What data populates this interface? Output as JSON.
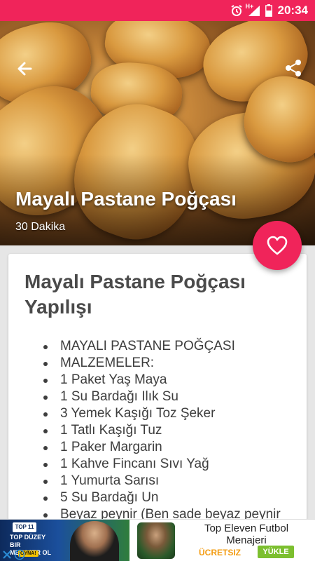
{
  "status_bar": {
    "time": "20:34",
    "network_label": "H+",
    "background": "#f0245a"
  },
  "recipe": {
    "title": "Mayalı Pastane Poğçası",
    "duration": "30 Dakika",
    "section_title": "Mayalı Pastane Poğçası Yapılışı",
    "ingredients": [
      "MAYALI PASTANE POĞÇASI",
      "MALZEMELER:",
      "1 Paket Yaş Maya",
      "1 Su Bardağı Ilık Su",
      "3 Yemek Kaşığı Toz Şeker",
      "1 Tatlı Kaşığı Tuz",
      "1 Paker Margarin",
      "1 Kahve Fincanı Sıvı Yağ",
      "1 Yumurta Sarısı",
      "5 Su Bardağı Un",
      "Beyaz peynir (Ben sade beyaz peynir"
    ]
  },
  "icons": {
    "back": "arrow-left-icon",
    "share": "share-icon",
    "favorite": "heart-outline-icon",
    "alarm": "alarm-clock-icon",
    "signal": "signal-icon",
    "battery": "battery-icon"
  },
  "ad": {
    "banner_logo": "TOP 11",
    "banner_text": "TOP DÜZEY BIR MENAJER OL",
    "banner_tag": "OYNA!",
    "title": "Top Eleven Futbol Menajeri",
    "price": "ÜCRETSIZ",
    "install_label": "YÜKLE"
  },
  "colors": {
    "accent": "#f0245a",
    "free": "#f39c12",
    "install": "#7cbf2f"
  }
}
